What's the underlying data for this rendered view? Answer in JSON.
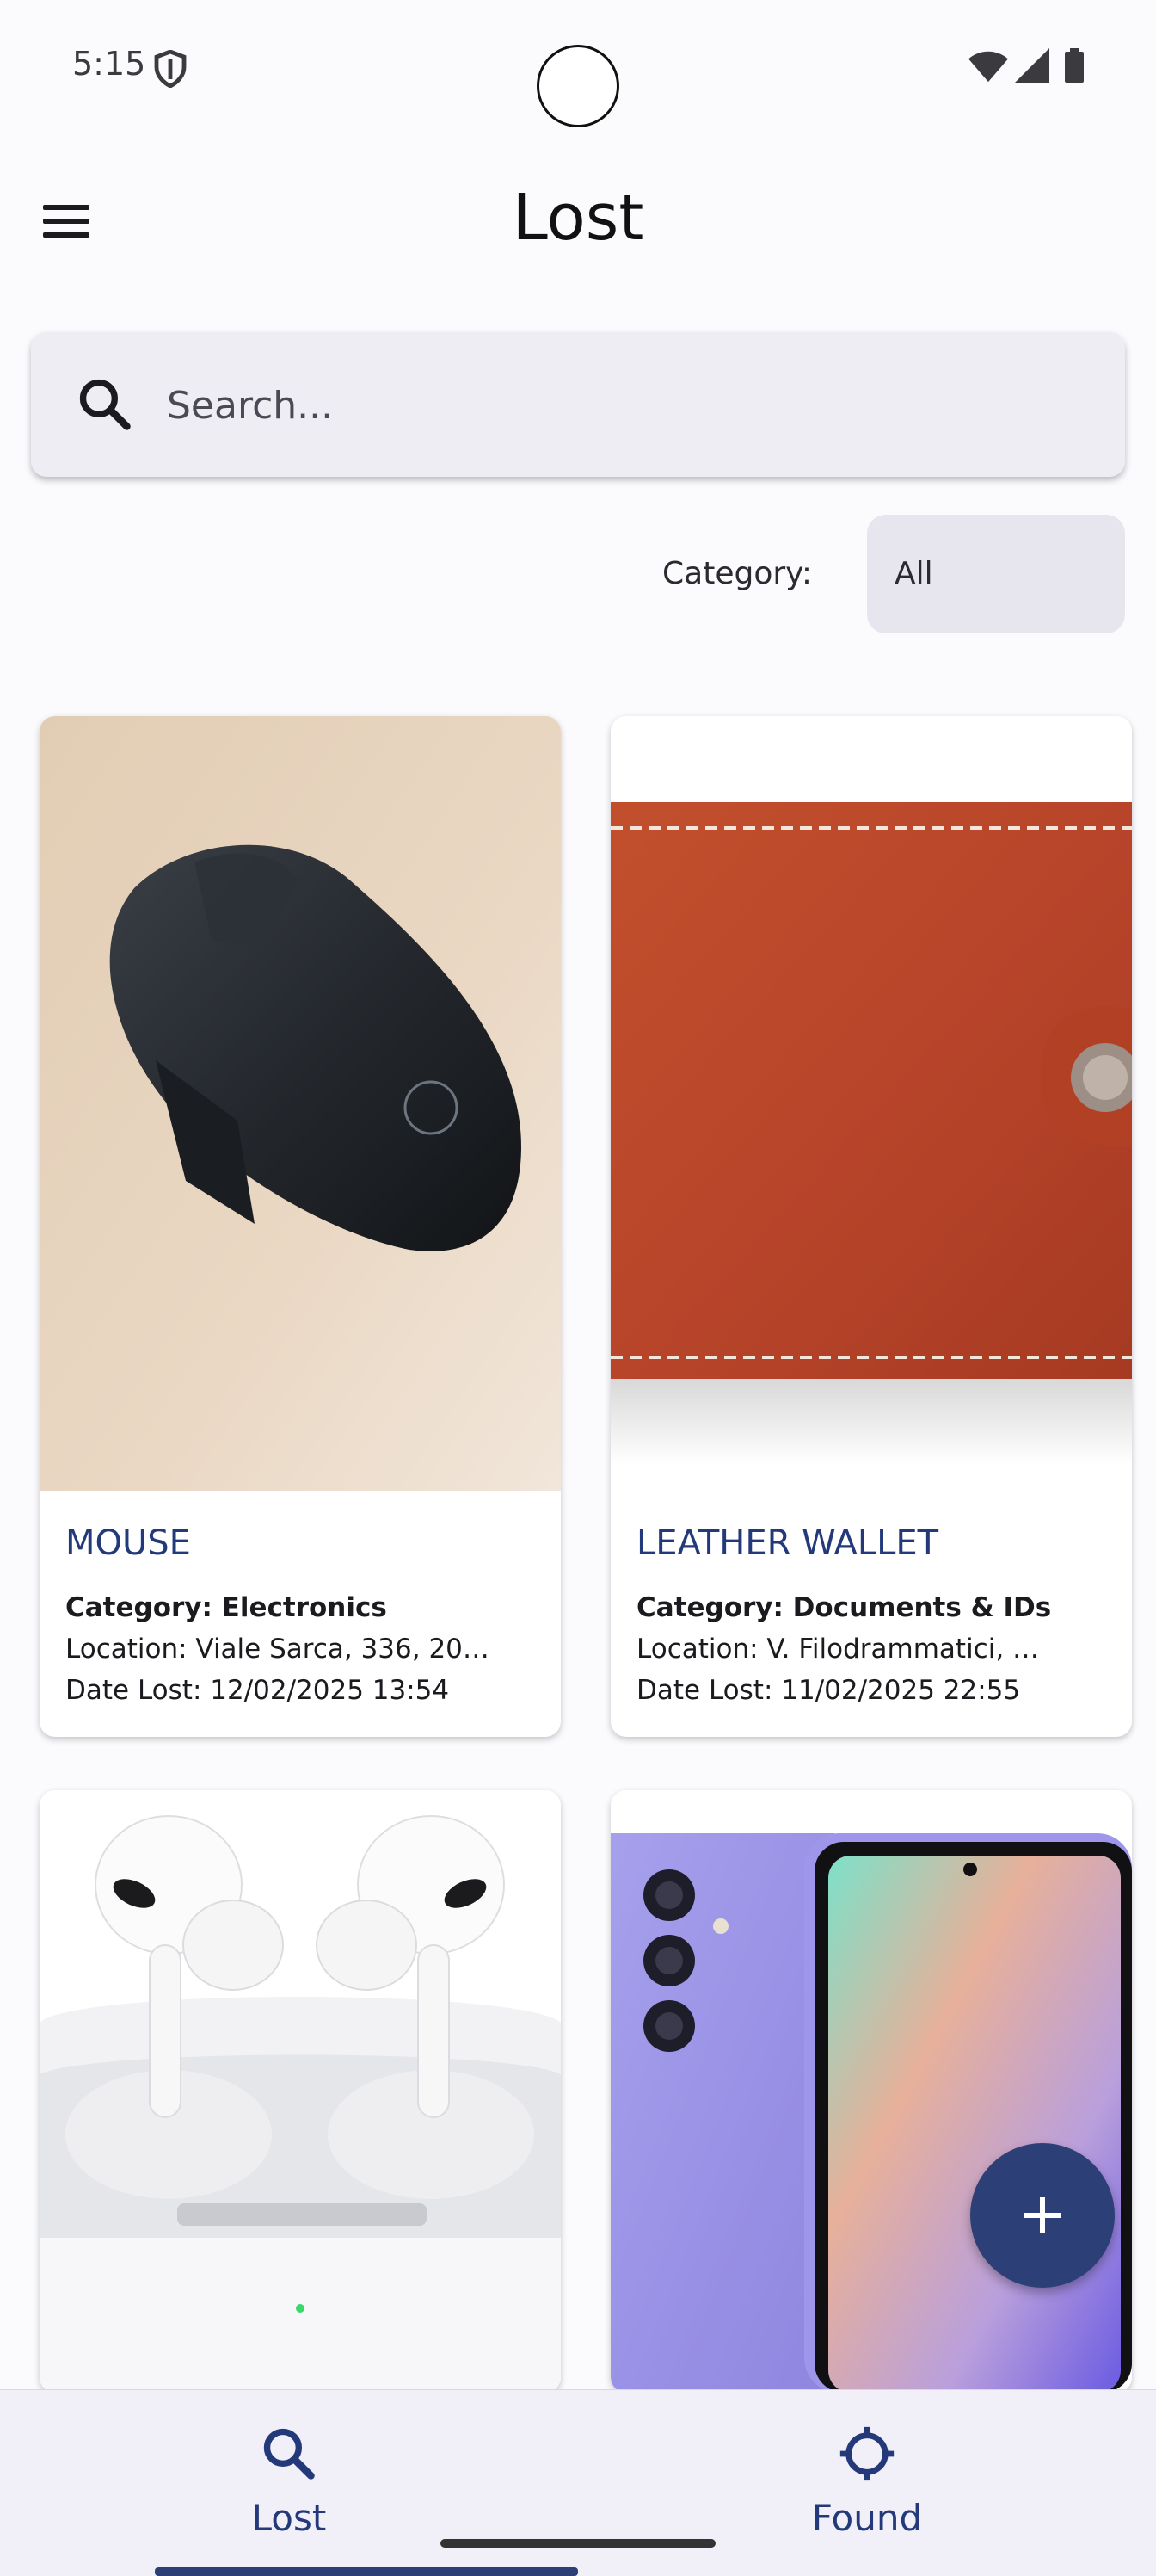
{
  "status_bar": {
    "time": "5:15"
  },
  "app_bar": {
    "title": "Lost",
    "menu_icon": "menu-icon"
  },
  "search": {
    "placeholder": "Search...",
    "value": ""
  },
  "filter": {
    "label": "Category:",
    "selected": "All"
  },
  "items": [
    {
      "title": "MOUSE",
      "category": "Category: Electronics",
      "location": "Location: Viale Sarca, 336, 20…",
      "date": "Date Lost: 12/02/2025 13:54"
    },
    {
      "title": "LEATHER WALLET",
      "category": "Category: Documents & IDs",
      "location": "Location: V. Filodrammatici, …",
      "date": "Date Lost: 11/02/2025 22:55"
    },
    {
      "title": "",
      "category": "",
      "location": "",
      "date": ""
    },
    {
      "title": "",
      "category": "",
      "location": "",
      "date": ""
    }
  ],
  "bottom_nav": [
    {
      "label": "Lost",
      "icon": "search-icon",
      "active": true
    },
    {
      "label": "Found",
      "icon": "crosshair-icon",
      "active": false
    }
  ],
  "colors": {
    "primary": "#2d3f77",
    "title_blue": "#23397a",
    "surface": "#eeedf4"
  }
}
